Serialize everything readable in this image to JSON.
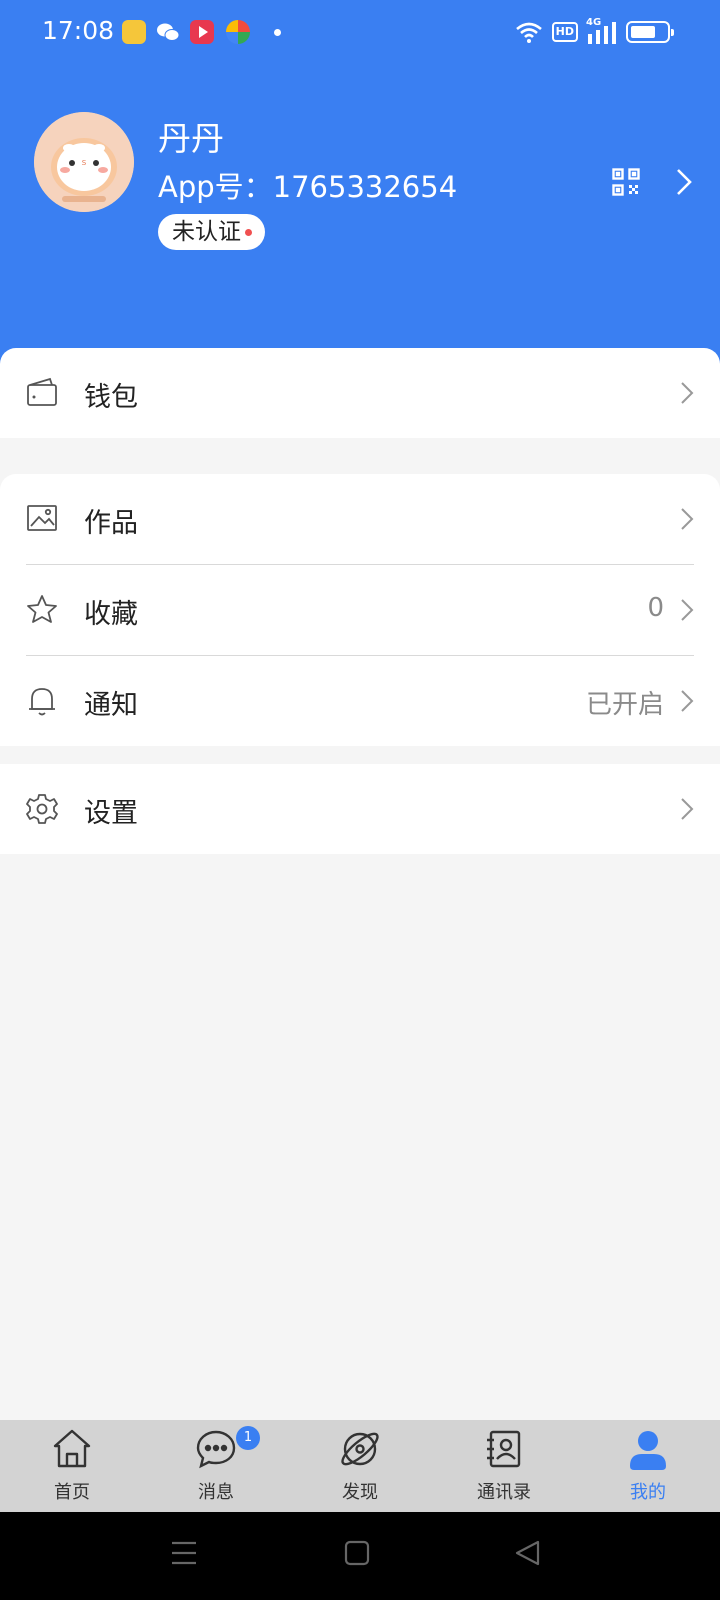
{
  "status_bar": {
    "time": "17:08",
    "network": "4G"
  },
  "profile": {
    "nickname": "丹丹",
    "app_id": "App号：1765332654",
    "verify_status": "未认证"
  },
  "menu": {
    "wallet": {
      "label": "钱包"
    },
    "works": {
      "label": "作品"
    },
    "favorites": {
      "label": "收藏",
      "value": "0"
    },
    "notifications": {
      "label": "通知",
      "value": "已开启"
    },
    "settings": {
      "label": "设置"
    }
  },
  "tabs": [
    {
      "label": "首页",
      "icon": "home-icon"
    },
    {
      "label": "消息",
      "icon": "chat-icon",
      "badge": "1"
    },
    {
      "label": "发现",
      "icon": "discover-icon"
    },
    {
      "label": "通讯录",
      "icon": "contacts-icon"
    },
    {
      "label": "我的",
      "icon": "person-icon",
      "active": true
    }
  ],
  "colors": {
    "primary": "#3a7ff2",
    "background": "#f5f5f5",
    "tabbar": "#d3d3d3",
    "dot": "#f05050"
  }
}
